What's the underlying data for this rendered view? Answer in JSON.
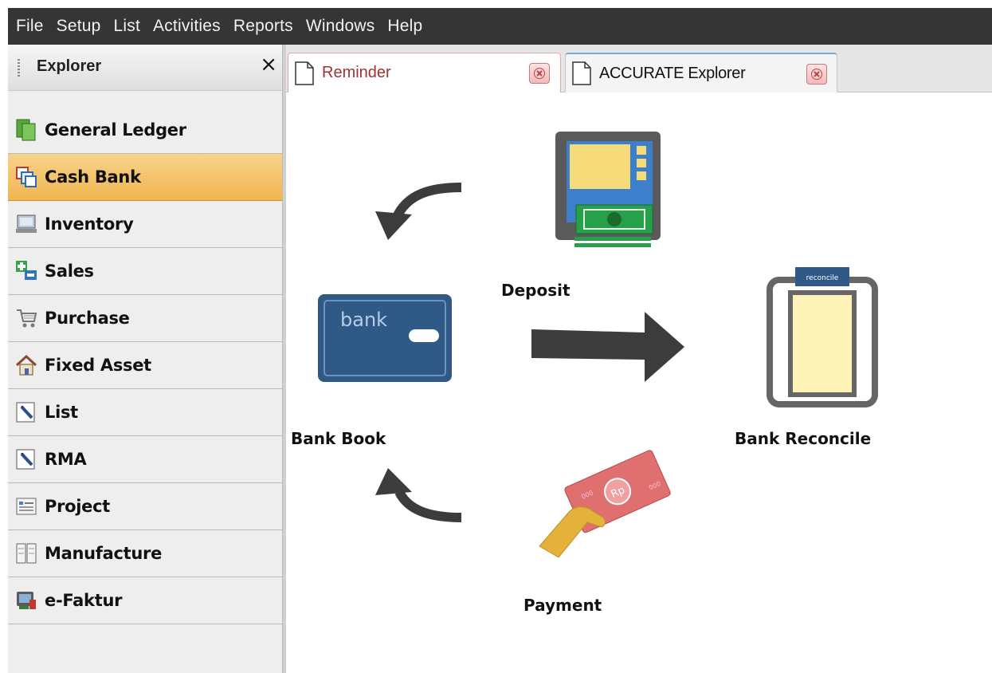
{
  "menu": [
    {
      "label": "File"
    },
    {
      "label": "Setup"
    },
    {
      "label": "List"
    },
    {
      "label": "Activities"
    },
    {
      "label": "Reports"
    },
    {
      "label": "Windows"
    },
    {
      "label": "Help"
    }
  ],
  "sidebar": {
    "title": "Explorer",
    "close_symbol": "×",
    "items": [
      {
        "label": "General Ledger",
        "icon": "general-ledger-icon"
      },
      {
        "label": "Cash Bank",
        "icon": "cash-bank-icon",
        "active": true
      },
      {
        "label": "Inventory",
        "icon": "inventory-icon"
      },
      {
        "label": "Sales",
        "icon": "sales-icon"
      },
      {
        "label": "Purchase",
        "icon": "purchase-cart-icon"
      },
      {
        "label": "Fixed Asset",
        "icon": "fixed-asset-house-icon"
      },
      {
        "label": "List",
        "icon": "list-icon"
      },
      {
        "label": "RMA",
        "icon": "rma-icon"
      },
      {
        "label": "Project",
        "icon": "project-icon"
      },
      {
        "label": "Manufacture",
        "icon": "manufacture-icon"
      },
      {
        "label": "e-Faktur",
        "icon": "e-faktur-icon"
      }
    ]
  },
  "tabs": [
    {
      "label": "Reminder",
      "active": false
    },
    {
      "label": "ACCURATE Explorer",
      "active": true
    }
  ],
  "diagram": {
    "deposit_label": "Deposit",
    "bank_book_label": "Bank Book",
    "bank_reconcile_label": "Bank Reconcile",
    "payment_label": "Payment",
    "bank_card_text": "bank",
    "reconcile_tag_text": "reconcile",
    "payment_note_text": "Rp"
  },
  "colors": {
    "menubar_bg": "#353535",
    "active_nav": "#f0b64f",
    "bank_card": "#2f5a88",
    "arrow": "#3c3c3c"
  }
}
